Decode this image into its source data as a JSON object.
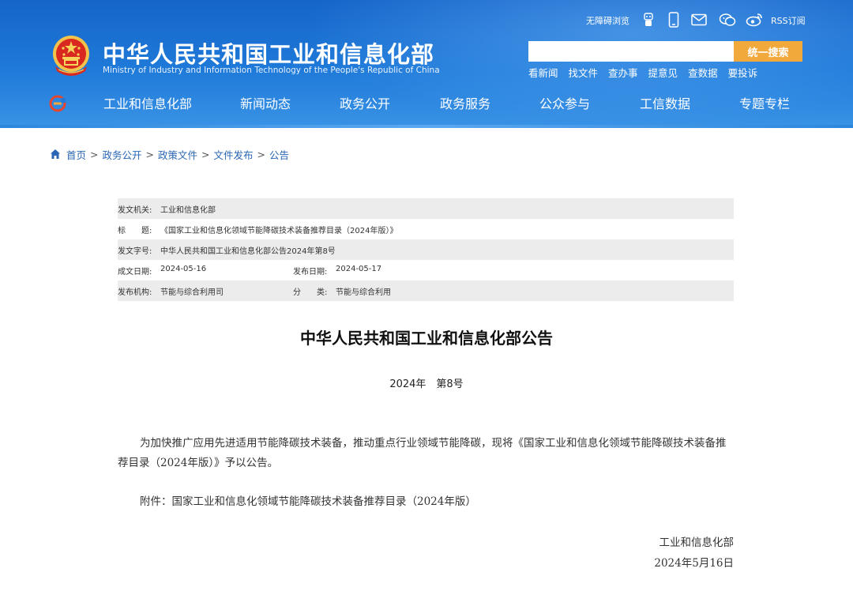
{
  "colors": {
    "header_blue": "#1f7ad9",
    "search_button": "#f2a93b",
    "link_blue": "#2a66b3",
    "meta_shade": "#ececec"
  },
  "header": {
    "title": "中华人民共和国工业和信息化部",
    "subtitle": "Ministry of Industry and Information Technology of the People's Republic of China",
    "accessibility_label": "无障碍浏览",
    "rss_label": "RSS订阅",
    "icons": [
      "robot-icon",
      "mobile-icon",
      "mail-icon",
      "wechat-icon",
      "weibo-icon",
      "rss-icon"
    ],
    "search": {
      "placeholder": "",
      "button_label": "统一搜索"
    },
    "quick_links": [
      "看新闻",
      "找文件",
      "查办事",
      "提意见",
      "查数据",
      "要投诉"
    ]
  },
  "nav": {
    "items": [
      "工业和信息化部",
      "新闻动态",
      "政务公开",
      "政务服务",
      "公众参与",
      "工信数据",
      "专题专栏"
    ]
  },
  "breadcrumb": {
    "items": [
      "首页",
      "政务公开",
      "政策文件",
      "文件发布",
      "公告"
    ],
    "separator": ">"
  },
  "meta": {
    "issuer_label": "发文机关:",
    "issuer": "工业和信息化部",
    "title_label": "标　　题:",
    "title": "《国家工业和信息化领域节能降碳技术装备推荐目录（2024年版）》",
    "doc_no_label": "发文字号:",
    "doc_no": "中华人民共和国工业和信息化部公告2024年第8号",
    "written_date_label": "成文日期:",
    "written_date": "2024-05-16",
    "publish_date_label": "发布日期:",
    "publish_date": "2024-05-17",
    "publisher_label": "发布机构:",
    "publisher": "节能与综合利用司",
    "category_label": "分　　类:",
    "category": "节能与综合利用"
  },
  "document": {
    "title": "中华人民共和国工业和信息化部公告",
    "number": "2024年　第8号",
    "paragraph_1": "为加快推广应用先进适用节能降碳技术装备，推动重点行业领域节能降碳，现将《国家工业和信息化领域节能降碳技术装备推荐目录（2024年版）》予以公告。",
    "paragraph_2": "附件：国家工业和信息化领域节能降碳技术装备推荐目录（2024年版）",
    "signature_org": "工业和信息化部",
    "signature_date": "2024年5月16日"
  }
}
